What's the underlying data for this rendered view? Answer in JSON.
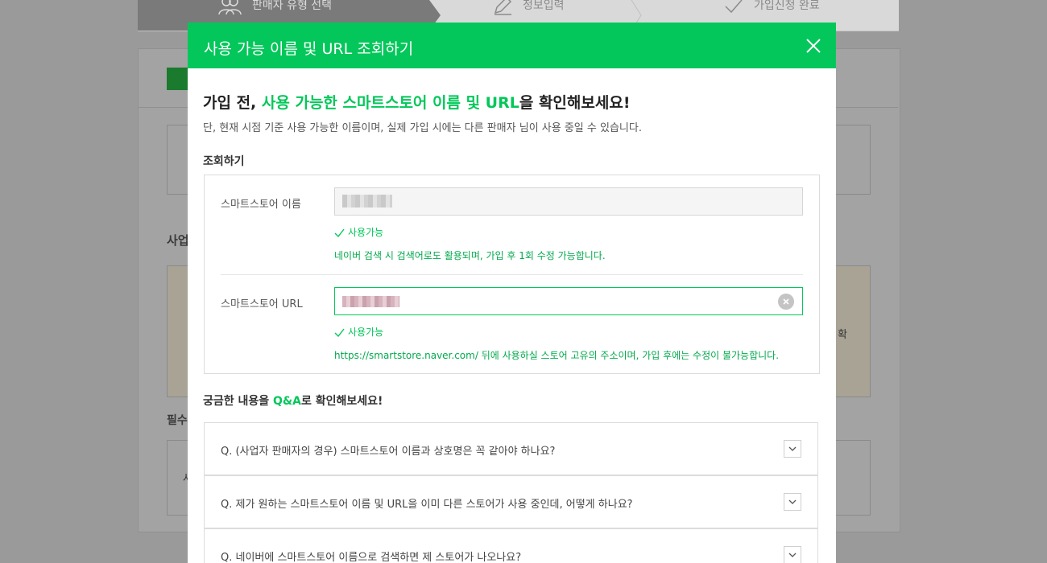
{
  "background": {
    "steps": [
      {
        "label": "판매자 유형 선택"
      },
      {
        "label": "정보입력"
      },
      {
        "label": "가입신청 완료"
      }
    ],
    "section1_label": "사업",
    "section2_label": "필수",
    "side_char": "확",
    "left_char": "사"
  },
  "modal": {
    "title": "사용 가능 이름 및 URL 조회하기",
    "headline_prefix": "가입 전, ",
    "headline_highlight": "사용 가능한 스마트스토어 이름 및 URL",
    "headline_suffix": "을 확인해보세요!",
    "subtext": "단, 현재 시점 기준 사용 가능한 이름이며, 실제 가입 시에는 다른 판매자 님이 사용 중일 수 있습니다.",
    "lookup_label": "조회하기",
    "name_field": {
      "label": "스마트스토어 이름",
      "status": "사용가능",
      "note": "네이버 검색 시 검색어로도 활용되며, 가입 후 1회 수정 가능합니다."
    },
    "url_field": {
      "label": "스마트스토어 URL",
      "status": "사용가능",
      "note": "https://smartstore.naver.com/ 뒤에 사용하실 스토어 고유의 주소이며, 가입 후에는 수정이 불가능합니다."
    },
    "qa_prefix": "궁금한 내용을 ",
    "qa_highlight": "Q&A",
    "qa_suffix": "로 확인해보세요!",
    "qa_items": [
      {
        "question": "Q. (사업자 판매자의 경우) 스마트스토어 이름과 상호명은 꼭 같아야 하나요?"
      },
      {
        "question": "Q. 제가 원하는 스마트스토어 이름 및 URL을 이미 다른 스토어가 사용 중인데, 어떻게 하나요?"
      },
      {
        "question": "Q. 네이버에 스마트스토어 이름으로 검색하면 제 스토어가 나오나요?"
      }
    ]
  },
  "colors": {
    "brand_green": "#03c75a",
    "overlay_gray": "#9a9a9a"
  }
}
